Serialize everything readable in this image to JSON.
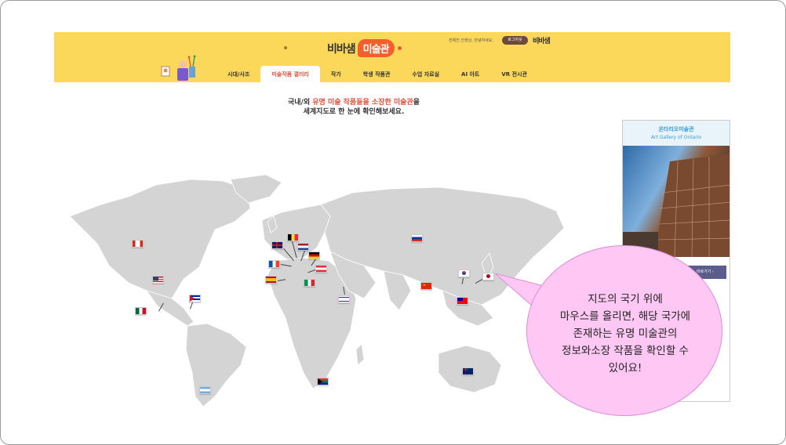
{
  "header": {
    "logo_part1": "비바샘",
    "logo_part2": "미술관",
    "greeting": "전체진 선생님, 안녕하세요.",
    "logout_label": "로그아웃",
    "brand_small": "비바샘",
    "bg_color": "#fbd75a",
    "accent_color": "#e2503a"
  },
  "nav": {
    "items": [
      {
        "label": "시대/사조"
      },
      {
        "label": "미술작품 갤러리"
      },
      {
        "label": "작가"
      },
      {
        "label": "학생 작품관"
      },
      {
        "label": "수업 자료실"
      },
      {
        "label": "AI 아트"
      },
      {
        "label": "VR 전시관"
      }
    ],
    "active": "미술작품 갤러리"
  },
  "intro": {
    "line1_prefix": "국내/외",
    "line1_highlight": "유명 미술 작품들을 소장한 미술관",
    "line1_suffix": "을",
    "line2": "세계지도로 한 눈에 확인해보세요."
  },
  "flags": [
    {
      "country": "canada"
    },
    {
      "country": "usa"
    },
    {
      "country": "mexico"
    },
    {
      "country": "cuba"
    },
    {
      "country": "argentina"
    },
    {
      "country": "uk"
    },
    {
      "country": "belgium"
    },
    {
      "country": "netherlands"
    },
    {
      "country": "germany"
    },
    {
      "country": "france"
    },
    {
      "country": "austria"
    },
    {
      "country": "spain"
    },
    {
      "country": "italy"
    },
    {
      "country": "israel"
    },
    {
      "country": "south-africa"
    },
    {
      "country": "russia"
    },
    {
      "country": "china"
    },
    {
      "country": "south-korea"
    },
    {
      "country": "japan"
    },
    {
      "country": "taiwan"
    },
    {
      "country": "australia"
    }
  ],
  "museum_panel": {
    "name_ko": "온타리오미술관",
    "name_en": "Art Gallery of Ontario",
    "button_label": "바로가기 ›"
  },
  "tooltip": {
    "line1": "지도의 국기 위에",
    "line2": "마우스를 올리면, 해당 국가에",
    "line3": "존재하는 유명 미술관의",
    "line4": "정보와소장 작품을 확인할 수",
    "line5": "있어요!"
  }
}
